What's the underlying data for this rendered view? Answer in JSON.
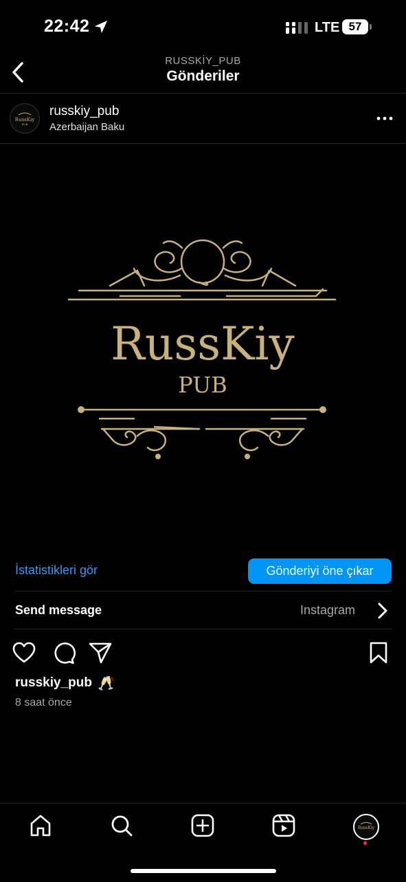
{
  "status_bar": {
    "time": "22:42",
    "network": "LTE",
    "battery": "57"
  },
  "header": {
    "account": "RUSSKİY_PUB",
    "title": "Gönderiler"
  },
  "post": {
    "username": "russkiy_pub",
    "location": "Azerbaijan Baku",
    "image": {
      "brand_name": "RussKiy",
      "brand_sub": "PUB",
      "accent_color": "#c9b27a"
    },
    "insights_label": "İstatistikleri gör",
    "boost_label": "Gönderiyi öne çıkar",
    "send_message_label": "Send message",
    "send_message_source": "Instagram",
    "caption_user": "russkiy_pub",
    "caption_emoji": "🥂",
    "time_ago": "8 saat önce"
  },
  "colors": {
    "background": "#000000",
    "link": "#3797f0",
    "button": "#0095f6",
    "secondary_text": "#a8a8a8"
  },
  "nav": {
    "items": [
      "home-icon",
      "search-icon",
      "create-icon",
      "reels-icon",
      "profile-avatar"
    ]
  }
}
